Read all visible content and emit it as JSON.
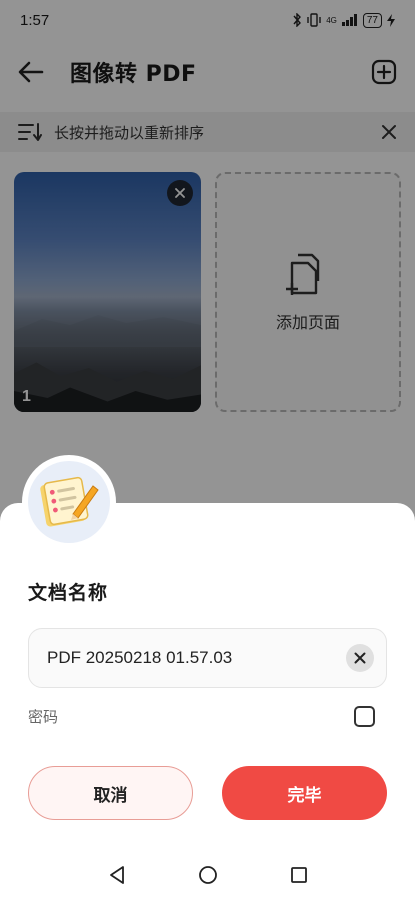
{
  "status": {
    "time": "1:57",
    "network": "4G",
    "battery": "77"
  },
  "appbar": {
    "title": "图像转 PDF"
  },
  "hint": {
    "text": "长按并拖动以重新排序"
  },
  "pages": [
    {
      "index": "1"
    }
  ],
  "add_page": {
    "label": "添加页面"
  },
  "dialog": {
    "title": "文档名称",
    "filename": "PDF 20250218 01.57.03",
    "password_label": "密码",
    "cancel_label": "取消",
    "done_label": "完毕"
  },
  "colors": {
    "accent": "#f04a44",
    "cancel_border": "#e89d96"
  }
}
